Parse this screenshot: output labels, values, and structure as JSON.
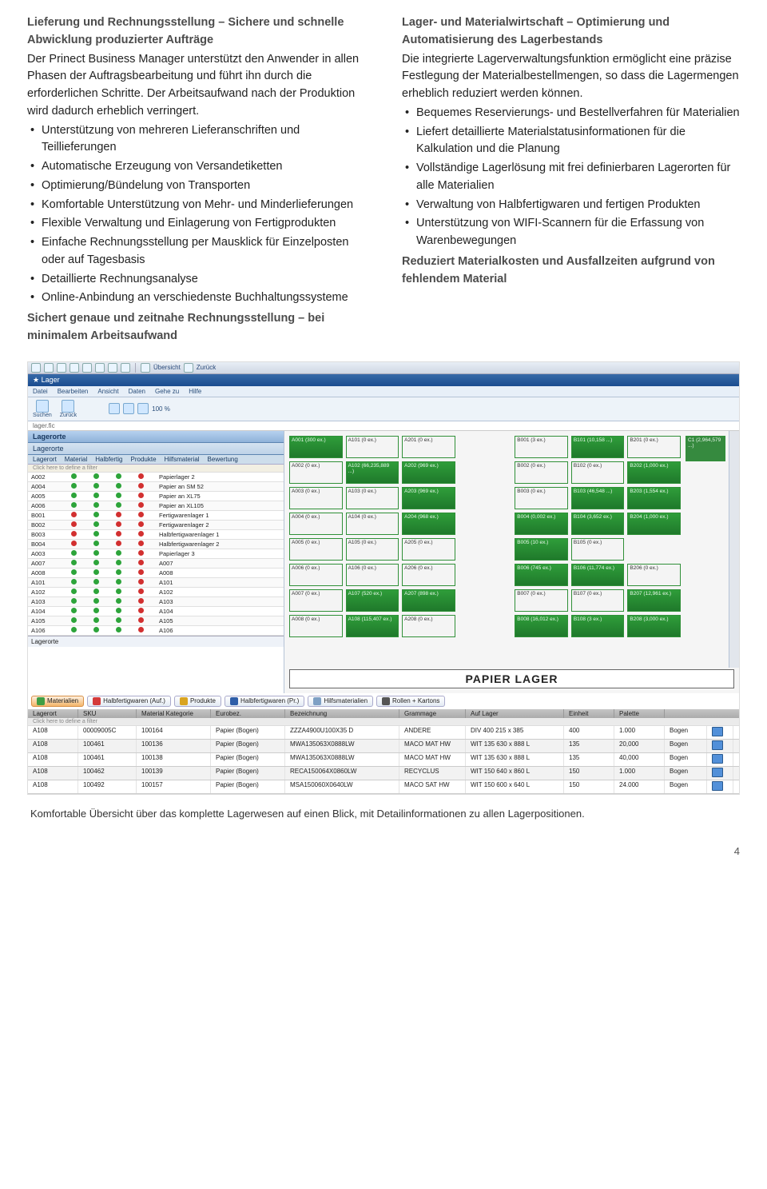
{
  "left": {
    "heading": "Lieferung und Rechnungsstellung – Sichere und schnelle Abwicklung produzierter Aufträge",
    "para": "Der Prinect Business Manager unterstützt den Anwender in allen Phasen der Auftragsbearbeitung und führt ihn durch die erforderlichen Schritte. Der Arbeitsaufwand nach der Produktion wird dadurch erheblich verringert.",
    "bullets": [
      "Unterstützung von mehreren Lieferanschriften und Teillieferungen",
      "Automatische Erzeugung von Versandetiketten",
      "Optimierung/Bündelung von Transporten",
      "Komfortable Unterstützung von Mehr- und Minderlieferungen",
      "Flexible Verwaltung und Einlagerung von Fertigprodukten",
      "Einfache Rechnungsstellung per Mausklick für Einzelposten oder auf Tagesbasis",
      "Detaillierte Rechnungsanalyse",
      "Online-Anbindung an verschiedenste Buchhaltungssysteme"
    ],
    "summary": "Sichert genaue und zeitnahe Rechnungsstellung – bei minimalem Arbeitsaufwand"
  },
  "right": {
    "heading": "Lager- und Materialwirtschaft – Optimierung und Automatisierung des Lagerbestands",
    "para": "Die integrierte Lagerverwaltungsfunktion ermöglicht eine präzise Festlegung der Materialbestellmengen, so dass die Lagermengen erheblich reduziert werden können.",
    "bullets": [
      "Bequemes Reservierungs- und Bestellverfahren für Materialien",
      "Liefert detaillierte Materialstatusinformationen für die Kalkulation und die Planung",
      "Vollständige Lagerlösung mit frei definierbaren Lagerorten für alle Materialien",
      "Verwaltung von Halbfertigwaren und fertigen Produkten",
      "Unterstützung von WIFI-Scannern für die Erfassung von Warenbewegungen"
    ],
    "summary": "Reduziert Materialkosten und Ausfallzeiten aufgrund von fehlendem Material"
  },
  "shot": {
    "winbar": {
      "overview": "Übersicht",
      "back": "Zurück"
    },
    "title": "Lager",
    "menus": [
      "Datei",
      "Bearbeiten",
      "Ansicht",
      "Daten",
      "Gehe zu",
      "Hilfe"
    ],
    "toolbar": {
      "search": "Suchen",
      "zurueck": "Zurück",
      "zoom": "100 %"
    },
    "path": "lager.fic",
    "panel": "Lagerorte",
    "panel2": "Lagerorte",
    "cols": [
      "Lagerort",
      "Material",
      "Halbfertig",
      "Produkte",
      "Hilfsmaterial",
      "Bewertung"
    ],
    "hint": "Click here to define a filter",
    "rows": [
      {
        "id": "A002",
        "d": [
          1,
          1,
          1,
          0
        ],
        "desc": "Papierlager 2"
      },
      {
        "id": "A004",
        "d": [
          1,
          1,
          1,
          0
        ],
        "desc": "Papier an SM 52"
      },
      {
        "id": "A005",
        "d": [
          1,
          1,
          1,
          0
        ],
        "desc": "Papier an XL75"
      },
      {
        "id": "A006",
        "d": [
          1,
          1,
          1,
          0
        ],
        "desc": "Papier an XL105"
      },
      {
        "id": "B001",
        "d": [
          0,
          1,
          0,
          0
        ],
        "desc": "Fertigwarenlager 1"
      },
      {
        "id": "B002",
        "d": [
          0,
          1,
          0,
          0
        ],
        "desc": "Fertigwarenlager 2"
      },
      {
        "id": "B003",
        "d": [
          0,
          1,
          0,
          0
        ],
        "desc": "Halbfertigwarenlager 1"
      },
      {
        "id": "B004",
        "d": [
          0,
          1,
          0,
          0
        ],
        "desc": "Halbfertigwarenlager 2"
      },
      {
        "id": "A003",
        "d": [
          1,
          1,
          1,
          0
        ],
        "desc": "Papierlager 3"
      },
      {
        "id": "A007",
        "d": [
          1,
          1,
          1,
          0
        ],
        "desc": "A007"
      },
      {
        "id": "A008",
        "d": [
          1,
          1,
          1,
          0
        ],
        "desc": "A008"
      },
      {
        "id": "A101",
        "d": [
          1,
          1,
          1,
          0
        ],
        "desc": "A101"
      },
      {
        "id": "A102",
        "d": [
          1,
          1,
          1,
          0
        ],
        "desc": "A102"
      },
      {
        "id": "A103",
        "d": [
          1,
          1,
          1,
          0
        ],
        "desc": "A103"
      },
      {
        "id": "A104",
        "d": [
          1,
          1,
          1,
          0
        ],
        "desc": "A104"
      },
      {
        "id": "A105",
        "d": [
          1,
          1,
          1,
          0
        ],
        "desc": "A105"
      },
      {
        "id": "A106",
        "d": [
          1,
          1,
          1,
          0
        ],
        "desc": "A106"
      }
    ],
    "tabs": [
      {
        "label": "Materialien",
        "color": "#3f9e44",
        "sel": true
      },
      {
        "label": "Halbfertigwaren (Auf.)",
        "color": "#d43a3a"
      },
      {
        "label": "Produkte",
        "color": "#d9a420"
      },
      {
        "label": "Halbfertigwaren (Pr.)",
        "color": "#2f5ea8"
      },
      {
        "label": "Hilfsmaterialien",
        "color": "#7ea0c4"
      },
      {
        "label": "Rollen + Kartons",
        "color": "#555"
      }
    ],
    "mcols": [
      "Lagerort",
      "SKU",
      "Material Kategorie",
      "Eurobez.",
      "Bezeichnung",
      "Grammage",
      "Auf Lager",
      "Einheit",
      "Palette"
    ],
    "mhint": "Click here to define a filter",
    "mrows": [
      [
        "A108",
        "00009005C",
        "100164",
        "Papier (Bogen)",
        "ZZZA4900U100X35 D",
        "ANDERE",
        "DIV 400 215 x 385",
        "400",
        "1.000",
        "Bogen"
      ],
      [
        "A108",
        "100461",
        "100136",
        "Papier (Bogen)",
        "MWA135063X0888LW",
        "MACO MAT HW",
        "WIT 135 630 x 888 L",
        "135",
        "20,000",
        "Bogen"
      ],
      [
        "A108",
        "100461",
        "100138",
        "Papier (Bogen)",
        "MWA135063X0888LW",
        "MACO MAT HW",
        "WIT 135 630 x 888 L",
        "135",
        "40,000",
        "Bogen"
      ],
      [
        "A108",
        "100462",
        "100139",
        "Papier (Bogen)",
        "RECA150064X0860LW",
        "RECYCLUS",
        "WIT 150 640 x 860 L",
        "150",
        "1.000",
        "Bogen"
      ],
      [
        "A108",
        "100492",
        "100157",
        "Papier (Bogen)",
        "MSA150060X0640LW",
        "MACO SAT HW",
        "WIT 150 600 x 640 L",
        "150",
        "24.000",
        "Bogen"
      ]
    ],
    "grid": [
      [
        "A001 (300 ex.)",
        "A101 (0 ex.)",
        "A201 (0 ex.)",
        "",
        "B001 (3 ex.)",
        "B101 (10,158 ...)",
        "B201 (0 ex.)"
      ],
      [
        "A002 (0 ex.)",
        "A102 (66,235,889 ...)",
        "A202 (969 ex.)",
        "",
        "B002 (0 ex.)",
        "B102 (0 ex.)",
        "B202 (1,000 ex.)"
      ],
      [
        "A003 (0 ex.)",
        "A103 (0 ex.)",
        "A203 (969 ex.)",
        "",
        "B003 (0 ex.)",
        "B103 (46,548 ...)",
        "B203 (1,554 ex.)"
      ],
      [
        "A004 (0 ex.)",
        "A104 (0 ex.)",
        "A204 (968 ex.)",
        "",
        "B004 (0,002 ex.)",
        "B104 (3,652 ex.)",
        "B204 (1,000 ex.)"
      ],
      [
        "A005 (0 ex.)",
        "A105 (0 ex.)",
        "A205 (0 ex.)",
        "",
        "B005 (10 ex.)",
        "B105 (0 ex.)",
        ""
      ],
      [
        "A006 (0 ex.)",
        "A106 (0 ex.)",
        "A206 (0 ex.)",
        "",
        "B006 (745 ex.)",
        "B106 (11,774 ex.)",
        "B206 (0 ex.)"
      ],
      [
        "A007 (0 ex.)",
        "A107 (520 ex.)",
        "A207 (898 ex.)",
        "",
        "B007 (0 ex.)",
        "B107 (0 ex.)",
        "B207 (12,961 ex.)"
      ],
      [
        "A008 (0 ex.)",
        "A108 (115,407 ex.)",
        "A208 (0 ex.)",
        "",
        "B008 (16,012 ex.)",
        "B108 (3 ex.)",
        "B208 (3,000 ex.)"
      ]
    ],
    "gridfill": [
      [
        1,
        0,
        0,
        0,
        0,
        1,
        0
      ],
      [
        0,
        1,
        1,
        0,
        0,
        0,
        1
      ],
      [
        0,
        0,
        1,
        0,
        0,
        1,
        1
      ],
      [
        0,
        0,
        1,
        0,
        1,
        1,
        1
      ],
      [
        0,
        0,
        0,
        0,
        1,
        0,
        0
      ],
      [
        0,
        0,
        0,
        0,
        1,
        1,
        0
      ],
      [
        0,
        1,
        1,
        0,
        0,
        0,
        1
      ],
      [
        0,
        1,
        0,
        0,
        1,
        1,
        1
      ]
    ],
    "gridcol8": [
      "C1 (2,964,579 ...)",
      "",
      "",
      "",
      "",
      "",
      "",
      ""
    ],
    "paplabel": "PAPIER LAGER"
  },
  "caption": "Komfortable Übersicht über das komplette Lagerwesen auf einen Blick, mit Detailinformationen zu allen Lagerpositionen.",
  "page": "4"
}
